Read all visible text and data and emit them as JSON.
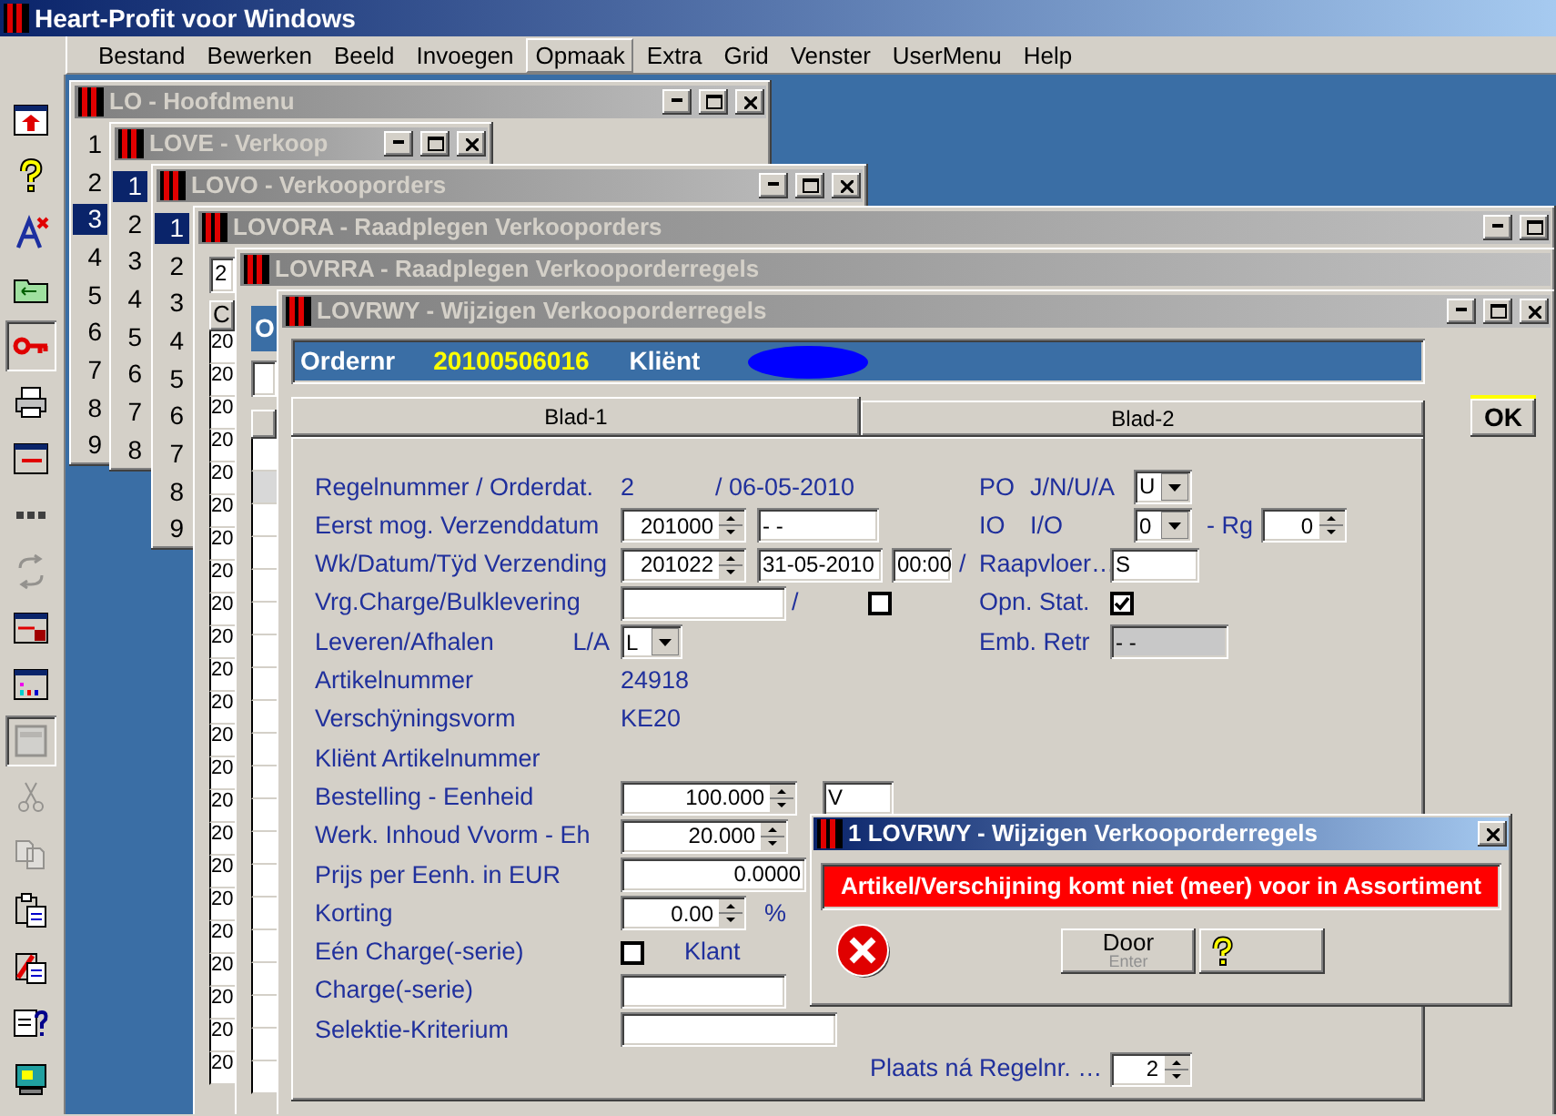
{
  "app": {
    "title": "Heart-Profit voor Windows"
  },
  "menu": [
    {
      "label": "Bestand",
      "selected": false
    },
    {
      "label": "Bewerken",
      "selected": false
    },
    {
      "label": "Beeld",
      "selected": false
    },
    {
      "label": "Invoegen",
      "selected": false
    },
    {
      "label": "Opmaak",
      "selected": true
    },
    {
      "label": "Extra",
      "selected": false
    },
    {
      "label": "Grid",
      "selected": false
    },
    {
      "label": "Venster",
      "selected": false
    },
    {
      "label": "UserMenu",
      "selected": false
    },
    {
      "label": "Help",
      "selected": false
    }
  ],
  "toolbar": [
    {
      "disabled": false,
      "pressed": false
    },
    {
      "disabled": false,
      "pressed": false
    },
    {
      "disabled": false,
      "pressed": false
    },
    {
      "disabled": false,
      "pressed": false
    },
    {
      "disabled": false,
      "pressed": true
    },
    {
      "disabled": false,
      "pressed": false
    },
    {
      "disabled": false,
      "pressed": false
    },
    {
      "disabled": false,
      "pressed": false
    },
    {
      "disabled": true,
      "pressed": false
    },
    {
      "disabled": false,
      "pressed": false
    },
    {
      "disabled": false,
      "pressed": false
    },
    {
      "disabled": true,
      "pressed": true
    },
    {
      "disabled": true,
      "pressed": false
    },
    {
      "disabled": true,
      "pressed": false
    },
    {
      "disabled": false,
      "pressed": false
    },
    {
      "disabled": false,
      "pressed": false
    },
    {
      "disabled": false,
      "pressed": false
    },
    {
      "disabled": false,
      "pressed": false
    }
  ],
  "windows": [
    {
      "kind": "menu",
      "title": "LO - Hoofdmenu",
      "active": false,
      "controls": [
        {
          "kind": "minimize"
        },
        {
          "kind": "maximize"
        },
        {
          "kind": "close"
        }
      ],
      "rows": [
        {
          "label": "1",
          "selected": false
        },
        {
          "label": "2",
          "selected": false
        },
        {
          "label": "3",
          "selected": true
        },
        {
          "label": "4",
          "selected": false
        },
        {
          "label": "5",
          "selected": false
        },
        {
          "label": "6",
          "selected": false
        },
        {
          "label": "7",
          "selected": false
        },
        {
          "label": "8",
          "selected": false
        },
        {
          "label": "9",
          "selected": false
        }
      ]
    },
    {
      "kind": "menu",
      "title": "LOVE - Verkoop",
      "active": false,
      "controls": [
        {
          "kind": "minimize"
        },
        {
          "kind": "maximize"
        },
        {
          "kind": "close"
        }
      ],
      "rows": [
        {
          "label": "1",
          "selected": true
        },
        {
          "label": "2",
          "selected": false
        },
        {
          "label": "3",
          "selected": false
        },
        {
          "label": "4",
          "selected": false
        },
        {
          "label": "5",
          "selected": false
        },
        {
          "label": "6",
          "selected": false
        },
        {
          "label": "7",
          "selected": false
        },
        {
          "label": "8",
          "selected": false
        }
      ]
    },
    {
      "kind": "menu",
      "title": "LOVO - Verkooporders",
      "active": false,
      "controls": [
        {
          "kind": "minimize"
        },
        {
          "kind": "maximize"
        },
        {
          "kind": "close"
        }
      ],
      "rows": [
        {
          "label": "1",
          "selected": true
        },
        {
          "label": "2",
          "selected": false
        },
        {
          "label": "3",
          "selected": false
        },
        {
          "label": "4",
          "selected": false
        },
        {
          "label": "5",
          "selected": false
        },
        {
          "label": "6",
          "selected": false
        },
        {
          "label": "7",
          "selected": false
        },
        {
          "label": "8",
          "selected": false
        },
        {
          "label": "9",
          "selected": false
        }
      ]
    },
    {
      "kind": "grid",
      "title": "LOVORA - Raadplegen Verkooporders",
      "active": false,
      "controls": [
        {
          "kind": "minimize"
        },
        {
          "kind": "maximize"
        }
      ],
      "field": "2",
      "header": "C",
      "cells": [
        "20",
        "20",
        "20",
        "20",
        "20",
        "20",
        "20",
        "20",
        "20",
        "20",
        "20",
        "20",
        "20",
        "20",
        "20",
        "20",
        "20",
        "20",
        "20",
        "20",
        "20",
        "20",
        "20"
      ]
    },
    {
      "kind": "list",
      "title": "LOVRRA - Raadplegen Verkooporderregels",
      "active": false,
      "header": "O",
      "rows": [
        {
          "selected": false
        },
        {
          "selected": true
        },
        {
          "selected": false
        },
        {
          "selected": false
        },
        {
          "selected": false
        },
        {
          "selected": false
        },
        {
          "selected": false
        },
        {
          "selected": false
        },
        {
          "selected": false
        },
        {
          "selected": false
        },
        {
          "selected": false
        },
        {
          "selected": false
        },
        {
          "selected": false
        },
        {
          "selected": false
        },
        {
          "selected": false
        },
        {
          "selected": false
        },
        {
          "selected": false
        },
        {
          "selected": false
        },
        {
          "selected": false
        },
        {
          "selected": false
        }
      ]
    },
    {
      "kind": "form",
      "title": "LOVRWY - Wijzigen Verkooporderregels",
      "active": false,
      "controls": [
        {
          "kind": "minimize"
        },
        {
          "kind": "maximize"
        },
        {
          "kind": "close"
        }
      ],
      "header": {
        "order_label": "Ordernr",
        "order": "20100506016",
        "client_label": "Kliënt"
      },
      "tabs": [
        {
          "label": "Blad-1",
          "selected": true
        },
        {
          "label": "Blad-2",
          "selected": false
        }
      ],
      "ok": "OK",
      "rows": [
        {
          "label": "Regelnummer / Orderdat.",
          "items": [
            {
              "kind": "text",
              "text": "2"
            },
            {
              "kind": "text",
              "text": "/ 06-05-2010"
            }
          ],
          "right": {
            "label": "PO",
            "unit": "J/N/U/A",
            "items": [
              {
                "kind": "select",
                "value": "U"
              }
            ]
          }
        },
        {
          "label": "Eerst mog. Verzenddatum",
          "items": [
            {
              "kind": "spin",
              "value": "201000"
            },
            {
              "kind": "field",
              "value": "- -",
              "disabled": false
            }
          ],
          "right": {
            "label": "IO",
            "unit": "I/O",
            "items": [
              {
                "kind": "select",
                "value": "0"
              },
              {
                "kind": "text",
                "text": "- Rg"
              },
              {
                "kind": "spin",
                "value": "0"
              }
            ]
          }
        },
        {
          "label": "Wk/Datum/Tÿd Verzending",
          "items": [
            {
              "kind": "spin",
              "value": "201022"
            },
            {
              "kind": "field",
              "value": "31-05-2010",
              "disabled": false
            },
            {
              "kind": "field",
              "value": "00:00",
              "disabled": false
            },
            {
              "kind": "text",
              "text": "/"
            }
          ],
          "right": {
            "label": "Raapvloer…",
            "items": [
              {
                "kind": "field",
                "value": "S",
                "disabled": false
              }
            ]
          }
        },
        {
          "label": "Vrg.Charge/Bulklevering",
          "items": [
            {
              "kind": "field",
              "disabled": false
            },
            {
              "kind": "text",
              "text": "/"
            },
            {
              "kind": "check",
              "checked": false
            }
          ],
          "right": {
            "label": "Opn. Stat.",
            "items": [
              {
                "kind": "check",
                "checked": true
              }
            ]
          }
        },
        {
          "label": "Leveren/Afhalen",
          "unit": "L/A",
          "items": [
            {
              "kind": "select",
              "value": "L"
            }
          ],
          "right": {
            "label": "Emb. Retr",
            "items": [
              {
                "kind": "field",
                "value": "- -",
                "disabled": true
              }
            ]
          }
        },
        {
          "label": "Artikelnummer",
          "items": [
            {
              "kind": "text",
              "text": "24918"
            }
          ]
        },
        {
          "label": "Verschÿningsvorm",
          "items": [
            {
              "kind": "text",
              "text": "KE20"
            }
          ]
        },
        {
          "label": "Kliënt Artikelnummer"
        },
        {
          "label": "Bestelling - Eenheid",
          "items": [
            {
              "kind": "spin",
              "value": "100.000"
            },
            {
              "kind": "field",
              "value": "V",
              "disabled": false
            }
          ]
        },
        {
          "label": "Werk. Inhoud Vvorm - Eh",
          "items": [
            {
              "kind": "spin",
              "value": "20.000"
            }
          ]
        },
        {
          "label": "Prijs per Eenh. in EUR",
          "items": [
            {
              "kind": "number",
              "value": "0.0000"
            }
          ]
        },
        {
          "label": "Korting",
          "items": [
            {
              "kind": "spin",
              "value": "0.00"
            },
            {
              "kind": "text",
              "text": "%"
            }
          ]
        },
        {
          "label": "Eén Charge(-serie)",
          "items": [
            {
              "kind": "check",
              "checked": false
            },
            {
              "kind": "text",
              "text": "Klant"
            }
          ]
        },
        {
          "label": "Charge(-serie)",
          "items": [
            {
              "kind": "field",
              "disabled": false
            }
          ]
        },
        {
          "label": "Selektie-Kriterium",
          "items": [
            {
              "kind": "field",
              "disabled": false
            }
          ]
        }
      ],
      "position": {
        "label": "Plaats ná Regelnr. …",
        "value": "2"
      }
    }
  ],
  "dialog": {
    "title": "1 LOVRWY - Wijzigen Verkooporderregels",
    "active": true,
    "message": "Artikel/Verschijning komt niet (meer) voor in Assortiment",
    "buttons": [
      {
        "kind": "text",
        "label": "Door",
        "hint": "Enter"
      },
      {
        "kind": "help"
      }
    ]
  }
}
